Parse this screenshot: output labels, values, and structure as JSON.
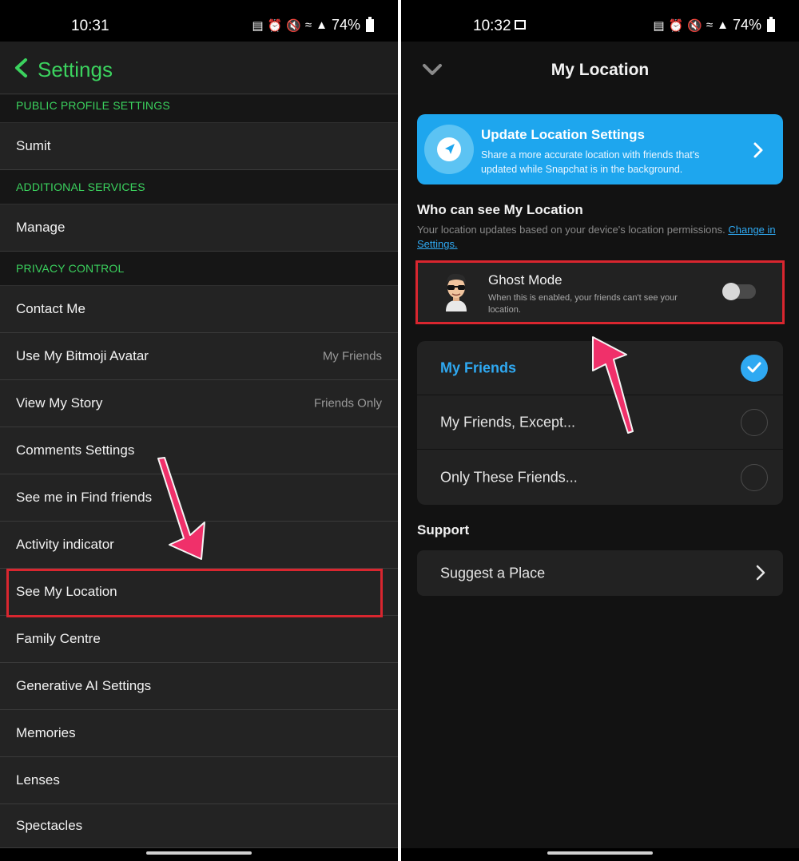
{
  "left": {
    "status": {
      "time": "10:31",
      "battery": "74%"
    },
    "header": {
      "title": "Settings"
    },
    "sections": [
      {
        "header": "PUBLIC PROFILE SETTINGS",
        "items": [
          {
            "label": "Sumit"
          }
        ]
      },
      {
        "header": "ADDITIONAL SERVICES",
        "items": [
          {
            "label": "Manage"
          }
        ]
      },
      {
        "header": "PRIVACY CONTROL",
        "items": [
          {
            "label": "Contact Me"
          },
          {
            "label": "Use My Bitmoji Avatar",
            "value": "My Friends"
          },
          {
            "label": "View My Story",
            "value": "Friends Only"
          },
          {
            "label": "Comments Settings"
          },
          {
            "label": "See me in Find friends"
          },
          {
            "label": "Activity indicator"
          },
          {
            "label": "See My Location"
          },
          {
            "label": "Family Centre"
          },
          {
            "label": "Generative AI Settings"
          },
          {
            "label": "Memories"
          },
          {
            "label": "Lenses"
          },
          {
            "label": "Spectacles"
          }
        ]
      }
    ]
  },
  "right": {
    "status": {
      "time": "10:32",
      "battery": "74%"
    },
    "header": {
      "title": "My Location"
    },
    "banner": {
      "title": "Update Location Settings",
      "text": "Share a more accurate location with friends that's updated while Snapchat is in the background."
    },
    "who": {
      "title": "Who can see My Location",
      "subtitle": "Your location updates based on your device's location permissions. ",
      "link": "Change in Settings."
    },
    "ghost_mode": {
      "title": "Ghost Mode",
      "subtitle": "When this is enabled, your friends can't see your location.",
      "enabled": false
    },
    "options": [
      {
        "label": "My Friends",
        "selected": true
      },
      {
        "label": "My Friends, Except...",
        "selected": false
      },
      {
        "label": "Only These Friends...",
        "selected": false
      }
    ],
    "support": {
      "title": "Support",
      "items": [
        {
          "label": "Suggest a Place"
        }
      ]
    }
  },
  "colors": {
    "accent_green": "#3bd25e",
    "accent_blue": "#2fa9f2",
    "highlight_red": "#d9262f",
    "arrow_pink": "#f0306a"
  }
}
